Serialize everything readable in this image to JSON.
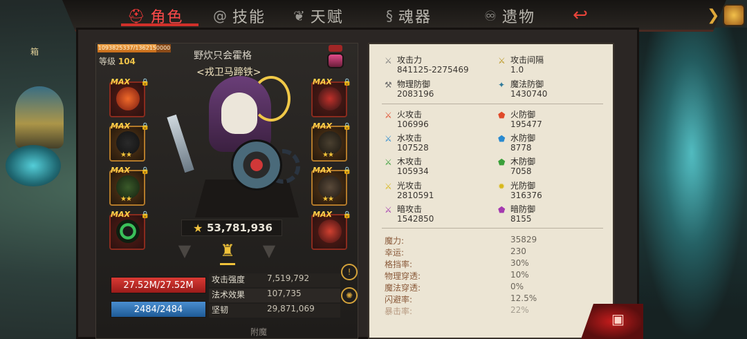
{
  "tabs": [
    {
      "label": "角色",
      "icon": "helmet-icon",
      "active": true
    },
    {
      "label": "技能",
      "icon": "swirl-icon",
      "active": false
    },
    {
      "label": "天赋",
      "icon": "wings-icon",
      "active": false
    },
    {
      "label": "魂器",
      "icon": "soul-icon",
      "active": false
    },
    {
      "label": "遗物",
      "icon": "relic-icon",
      "active": false
    }
  ],
  "colors": {
    "accent": "#ff4a4a",
    "gold": "#f0c348",
    "panel": "#ece5d4"
  },
  "side_label": "箱",
  "character": {
    "xp_text": "1093825337/1362150000",
    "xp_fraction": 0.8,
    "level_label": "等级",
    "level": "104",
    "name": "野炊只会霍格",
    "title": "<戎卫马蹄铁>",
    "power": "53,781,936",
    "hp": "27.52M/27.52M",
    "mp": "2484/2484"
  },
  "equipment_left": [
    {
      "max": "MAX",
      "stars": ""
    },
    {
      "max": "MAX",
      "stars": "★★"
    },
    {
      "max": "MAX",
      "stars": "★★"
    },
    {
      "max": "MAX",
      "stars": ""
    }
  ],
  "equipment_right": [
    {
      "max": "MAX",
      "stars": ""
    },
    {
      "max": "MAX",
      "stars": "★★"
    },
    {
      "max": "MAX",
      "stars": "★★"
    },
    {
      "max": "MAX",
      "stars": ""
    }
  ],
  "sub_stats": [
    {
      "label": "攻击强度",
      "value": "7,519,792"
    },
    {
      "label": "法术效果",
      "value": "107,735"
    },
    {
      "label": "坚韧",
      "value": "29,871,069"
    }
  ],
  "attach_label": "附魔",
  "stats": {
    "attack": {
      "label": "攻击力",
      "value": "841125-2275469"
    },
    "interval": {
      "label": "攻击间隔",
      "value": "1.0"
    },
    "phys_def": {
      "label": "物理防御",
      "value": "2083196"
    },
    "magic_def": {
      "label": "魔法防御",
      "value": "1430740"
    },
    "fire_atk": {
      "label": "火攻击",
      "value": "106996"
    },
    "fire_def": {
      "label": "火防御",
      "value": "195477"
    },
    "water_atk": {
      "label": "水攻击",
      "value": "107528"
    },
    "water_def": {
      "label": "水防御",
      "value": "8778"
    },
    "wood_atk": {
      "label": "木攻击",
      "value": "105934"
    },
    "wood_def": {
      "label": "木防御",
      "value": "7058"
    },
    "light_atk": {
      "label": "光攻击",
      "value": "2810591"
    },
    "light_def": {
      "label": "光防御",
      "value": "316376"
    },
    "dark_atk": {
      "label": "暗攻击",
      "value": "1542850"
    },
    "dark_def": {
      "label": "暗防御",
      "value": "8155"
    }
  },
  "misc_stats": [
    {
      "label": "魔力:",
      "value": "35829"
    },
    {
      "label": "幸运:",
      "value": "230"
    },
    {
      "label": "格挡率:",
      "value": "30%"
    },
    {
      "label": "物理穿透:",
      "value": "10%"
    },
    {
      "label": "魔法穿透:",
      "value": "0%"
    },
    {
      "label": "闪避率:",
      "value": "12.5%"
    },
    {
      "label": "暴击率:",
      "value": "22%"
    }
  ]
}
